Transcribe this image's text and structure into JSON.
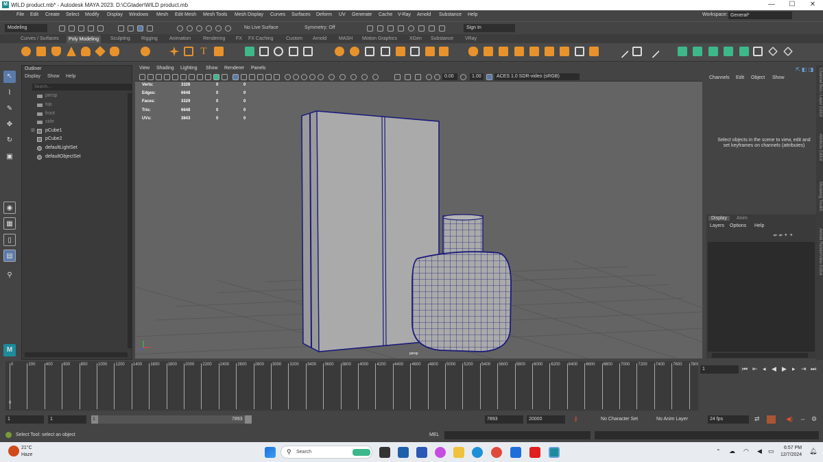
{
  "window": {
    "title": "WILD product.mb* - Autodesk MAYA 2023: D:\\CGtader\\WILD product.mb",
    "logo": "M",
    "minimize": "—",
    "maximize": "☐",
    "close": "✕"
  },
  "menu": {
    "items": [
      "File",
      "Edit",
      "Create",
      "Select",
      "Modify",
      "Display",
      "Windows",
      "Mesh",
      "Edit Mesh",
      "Mesh Tools",
      "Mesh Display",
      "Curves",
      "Surfaces",
      "Deform",
      "UV",
      "Generate",
      "Cache",
      "V-Ray",
      "Arnold",
      "Substance",
      "Help"
    ],
    "workspace_label": "Workspace:",
    "workspace_value": "General*"
  },
  "statusline": {
    "menuset": "Modeling",
    "live_surface": "No Live Surface",
    "symmetry": "Symmetry: Off",
    "sign_in": "Sign In"
  },
  "shelf": {
    "tabs": [
      "Curves / Surfaces",
      "Poly Modeling",
      "Sculpting",
      "Rigging",
      "Animation",
      "Rendering",
      "FX",
      "FX Caching",
      "Custom",
      "Arnold",
      "MASH",
      "Motion Graphics",
      "XGen",
      "Substance",
      "VRay"
    ],
    "active_tab": "Poly Modeling",
    "colors": {
      "orange": "#e8922c",
      "teal": "#3db88a",
      "white": "#dddddd"
    }
  },
  "outliner": {
    "title": "Outliner",
    "menus": [
      "Display",
      "Show",
      "Help"
    ],
    "search_placeholder": "Search...",
    "items": [
      {
        "label": "persp",
        "type": "camera",
        "dim": true
      },
      {
        "label": "top",
        "type": "camera",
        "dim": true
      },
      {
        "label": "front",
        "type": "camera",
        "dim": true
      },
      {
        "label": "side",
        "type": "camera",
        "dim": true
      },
      {
        "label": "pCube1",
        "type": "mesh",
        "dim": false
      },
      {
        "label": "pCube2",
        "type": "mesh",
        "dim": false
      },
      {
        "label": "defaultLightSet",
        "type": "set",
        "dim": false
      },
      {
        "label": "defaultObjectSet",
        "type": "set",
        "dim": false
      }
    ]
  },
  "viewport": {
    "menus": [
      "View",
      "Shading",
      "Lighting",
      "Show",
      "Renderer",
      "Panels"
    ],
    "near_clip": "0.00",
    "far_clip": "1.00",
    "color_space": "ACES 1.0 SDR-video (sRGB)",
    "camera_label": "persp",
    "hud": [
      {
        "label": "Verts:",
        "values": [
          "3326",
          "0",
          "0"
        ]
      },
      {
        "label": "Edges:",
        "values": [
          "6648",
          "0",
          "0"
        ]
      },
      {
        "label": "Faces:",
        "values": [
          "3329",
          "0",
          "0"
        ]
      },
      {
        "label": "Tris:",
        "values": [
          "6648",
          "0",
          "0"
        ]
      },
      {
        "label": "UVs:",
        "values": [
          "3843",
          "0",
          "0"
        ]
      }
    ],
    "colors": {
      "background": "#646464",
      "grid": "#555555",
      "mesh": "#aaaaaa",
      "wire": "#1a1a7a"
    }
  },
  "channelbox": {
    "menus": [
      "Channels",
      "Edit",
      "Object",
      "Show"
    ],
    "message": "Select objects in the scene to view, edit and set keyframes on channels (attributes)",
    "layer_tabs": [
      "Display",
      "Anim"
    ],
    "layer_menus": [
      "Layers",
      "Options",
      "Help"
    ],
    "side_tabs": [
      "Channel Box / Layer Editor",
      "Attribute Editor",
      "Modeling Toolkit",
      "Arnold RenderView Editor"
    ]
  },
  "timeline": {
    "ticks": [
      "0",
      "200",
      "400",
      "600",
      "800",
      "1000",
      "1200",
      "1400",
      "1600",
      "1800",
      "2000",
      "2200",
      "2400",
      "2600",
      "2800",
      "3000",
      "3200",
      "3400",
      "3600",
      "3800",
      "4000",
      "4200",
      "4400",
      "4600",
      "4800",
      "5000",
      "5200",
      "5400",
      "5600",
      "5800",
      "6000",
      "6200",
      "6400",
      "6600",
      "6800",
      "7000",
      "7200",
      "7400",
      "7600",
      "7800"
    ],
    "current_frame": "1",
    "start_marker": "0"
  },
  "range": {
    "start": "1",
    "playback_start": "1",
    "slider_start": "1",
    "slider_end": "7893",
    "playback_end": "7893",
    "end": "20000",
    "character_set": "No Character Set",
    "anim_layer": "No Anim Layer",
    "fps": "24 fps"
  },
  "command": {
    "help": "Select Tool: select an object",
    "lang": "MEL"
  },
  "taskbar": {
    "temp": "21°C",
    "weather": "Haze",
    "search": "Search",
    "time": "6:57 PM",
    "date": "12/7/2024"
  }
}
